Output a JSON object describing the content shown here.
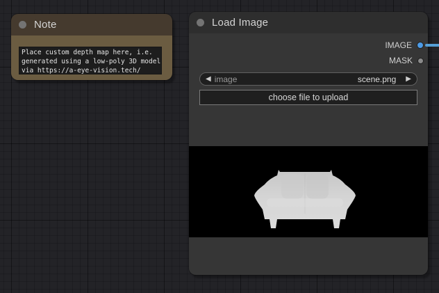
{
  "note_node": {
    "title": "Note",
    "text": "Place custom depth map here, i.e.\ngenerated using a low-poly 3D model\nvia https://a-eye-vision.tech/"
  },
  "load_image_node": {
    "title": "Load Image",
    "outputs": [
      {
        "label": "IMAGE",
        "connected": true,
        "color": "#4d9be6"
      },
      {
        "label": "MASK",
        "connected": false,
        "color": "#8a8a8a"
      }
    ],
    "image_combo": {
      "left_arrow": "◀",
      "label": "image",
      "value": "scene.png",
      "right_arrow": "▶"
    },
    "upload_button_label": "choose file to upload",
    "preview_description": "grayscale depth map of a two-seat sofa on black background"
  },
  "colors": {
    "canvas_background": "#232327",
    "note_header": "#453a2e",
    "note_body": "#6b5c41",
    "node_header": "#2e2e2e",
    "node_body": "#363636",
    "link_blue": "#569fd6",
    "widget_background": "#1f1f1f"
  }
}
